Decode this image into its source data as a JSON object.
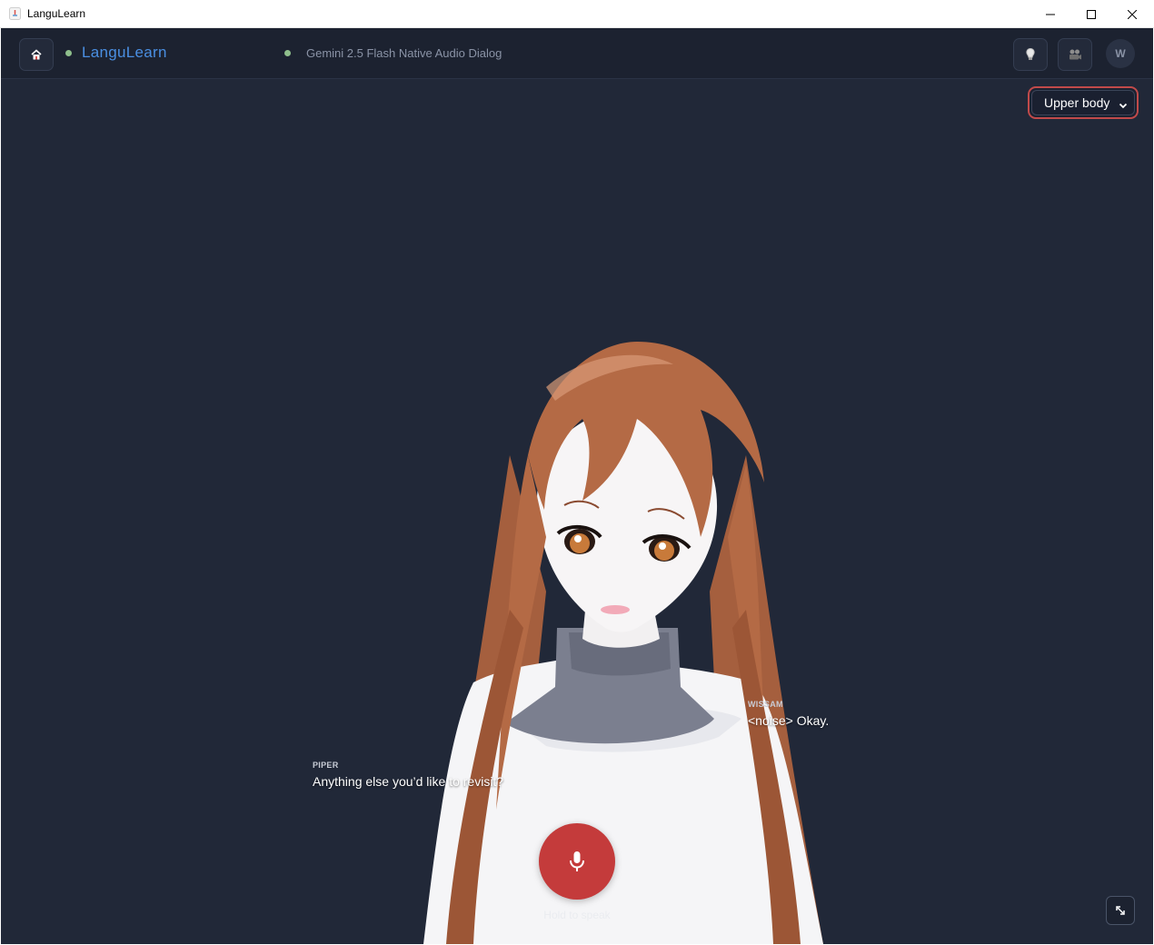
{
  "window": {
    "title": "LanguLearn",
    "icon": "app-logo-icon"
  },
  "header": {
    "home_icon": "home-icon",
    "brand": "LanguLearn",
    "model": "Gemini 2.5 Flash Native Audio Dialog",
    "status_color": "#8fbf8c",
    "brand_color": "#4a8fe2",
    "buttons": [
      {
        "icon": "lightbulb-icon"
      },
      {
        "icon": "camera-icon"
      }
    ],
    "user_initial": "W"
  },
  "view_select": {
    "value": "Upper body",
    "options": [
      "Upper body"
    ],
    "focus_color": "#c14a4a"
  },
  "captions": {
    "assistant": {
      "speaker": "PIPER",
      "text": "Anything else you’d like to revisit?"
    },
    "user": {
      "speaker": "WISSAM",
      "text": "<noise> Okay."
    }
  },
  "mic": {
    "label": "Hold to speak",
    "icon": "microphone-icon",
    "color": "#c43b3b"
  },
  "expand": {
    "icon": "expand-icon"
  },
  "colors": {
    "background": "#212838",
    "header": "#1c2230"
  }
}
